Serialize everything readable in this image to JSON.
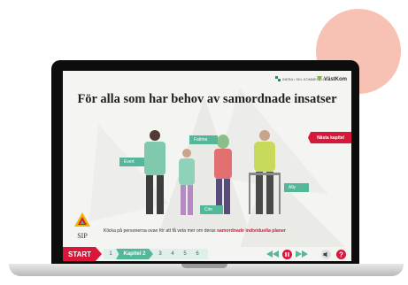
{
  "colors": {
    "accent_red": "#d8173a",
    "accent_green": "#55b79a",
    "background_circle": "#f7c2b4"
  },
  "logos": {
    "left": "INERA / SKL KOMMENTUS",
    "right": "VästKom"
  },
  "slide": {
    "title": "För alla som har behov av samordnade insatser",
    "next_chapter_button": "Nästa kapitel",
    "people_labels": [
      "Evert",
      "Fatima",
      "Cim",
      "Ally"
    ],
    "instruction_prefix": "Klicka på personerna ovan för att få veta mer om deras ",
    "instruction_highlight": "samordnade individuella planer"
  },
  "brand": {
    "sip_label": "SIP"
  },
  "nav": {
    "start_label": "START",
    "chapters": [
      "1",
      "Kapitel 2",
      "3",
      "4",
      "5",
      "6"
    ],
    "active_chapter_index": 1,
    "controls": [
      "rewind-icon",
      "pause-icon",
      "forward-icon",
      "volume-icon",
      "help-icon"
    ]
  }
}
